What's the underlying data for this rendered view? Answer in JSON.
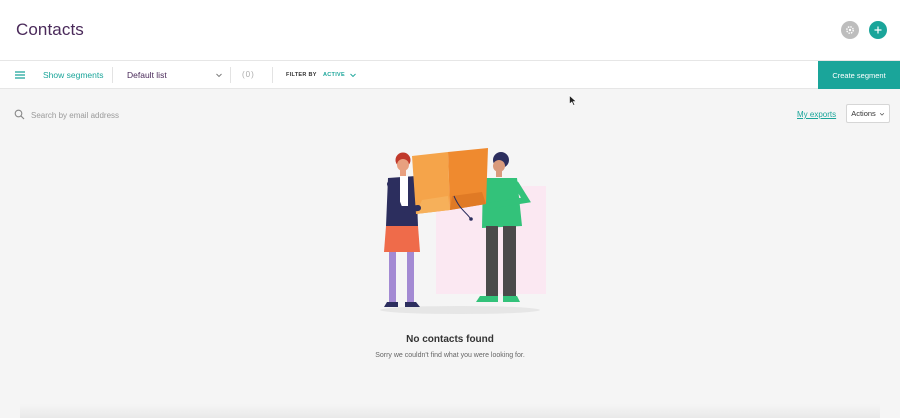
{
  "header": {
    "title": "Contacts",
    "settings_icon": "gear-icon",
    "add_icon": "plus-icon"
  },
  "toolbar": {
    "menu_icon": "hamburger-icon",
    "show_segments": "Show segments",
    "list_selected": "Default list",
    "count": "(0)",
    "filter_label": "FILTER BY",
    "filter_value": "ACTIVE",
    "create_segment": "Create segment"
  },
  "search": {
    "placeholder": "Search by email address",
    "value": ""
  },
  "links": {
    "my_exports": "My exports",
    "actions": "Actions"
  },
  "empty_state": {
    "title": "No contacts found",
    "subtitle": "Sorry we couldn't find what you were looking for."
  },
  "colors": {
    "accent": "#1aa59a",
    "title": "#4a2a5a",
    "background": "#f5f5f5"
  }
}
